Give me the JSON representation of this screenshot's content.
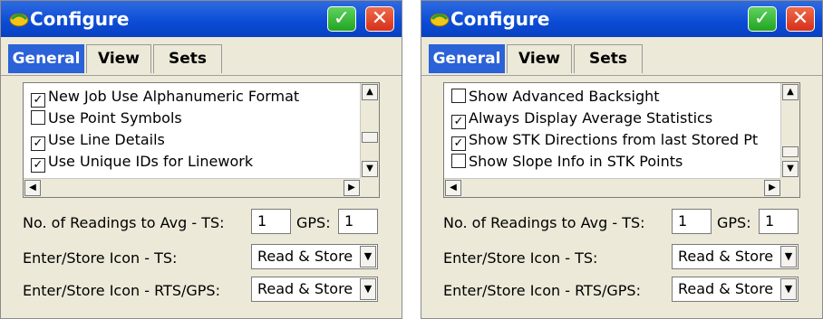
{
  "colors": {
    "title_bar": "#0a4bd6",
    "active_tab": "#2b62d8",
    "ok_green": "#21a521",
    "close_red": "#d6301a",
    "dialog_bg": "#ece9d8"
  },
  "icons": {
    "app_logo": "app-logo-icon",
    "ok": "check",
    "close": "close",
    "up": "▲",
    "down": "▼",
    "left": "◀",
    "right": "▶",
    "check": "✓"
  },
  "left": {
    "title": "Configure",
    "tabs": [
      {
        "label": "General"
      },
      {
        "label": "View"
      },
      {
        "label": "Sets"
      }
    ],
    "options": [
      {
        "label": "New Job Use Alphanumeric Format",
        "checked": true,
        "mark": "✓"
      },
      {
        "label": "Use Point Symbols",
        "checked": false,
        "mark": ""
      },
      {
        "label": "Use Line Details",
        "checked": true,
        "mark": "✓"
      },
      {
        "label": "Use Unique IDs for Linework",
        "checked": true,
        "mark": "✓"
      }
    ],
    "readings_label": "No. of Readings to Avg  -  TS:",
    "ts_value": "1",
    "gps_label": "GPS:",
    "gps_value": "1",
    "store_icon_ts_label": "Enter/Store Icon - TS:",
    "store_icon_ts_value": "Read & Store",
    "store_icon_rts_label": "Enter/Store Icon - RTS/GPS:",
    "store_icon_rts_value": "Read & Store"
  },
  "right": {
    "title": "Configure",
    "tabs": [
      {
        "label": "General"
      },
      {
        "label": "View"
      },
      {
        "label": "Sets"
      }
    ],
    "options": [
      {
        "label": "Show Advanced Backsight",
        "checked": false,
        "mark": ""
      },
      {
        "label": "Always Display Average Statistics",
        "checked": true,
        "mark": "✓"
      },
      {
        "label": "Show STK Directions from last Stored Pt",
        "checked": true,
        "mark": "✓"
      },
      {
        "label": "Show Slope Info in STK Points",
        "checked": false,
        "mark": ""
      }
    ],
    "readings_label": "No. of Readings to Avg  -  TS:",
    "ts_value": "1",
    "gps_label": "GPS:",
    "gps_value": "1",
    "store_icon_ts_label": "Enter/Store Icon - TS:",
    "store_icon_ts_value": "Read & Store",
    "store_icon_rts_label": "Enter/Store Icon - RTS/GPS:",
    "store_icon_rts_value": "Read & Store"
  }
}
